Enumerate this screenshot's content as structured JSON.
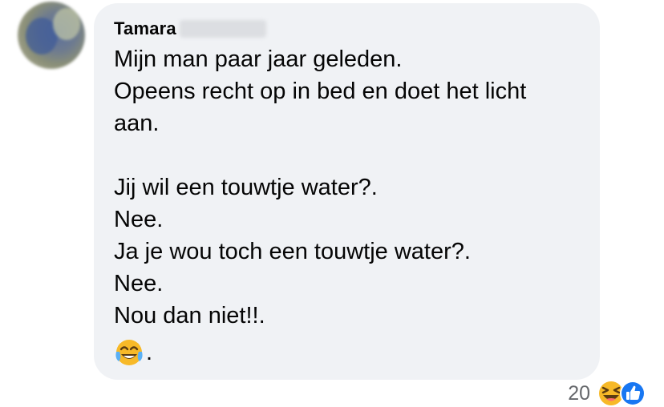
{
  "comment": {
    "author": "Tamara",
    "lines": [
      "Mijn man paar jaar geleden.",
      "Opeens recht op in bed en doet het licht",
      "aan.",
      "",
      "Jij wil een touwtje water?.",
      "Nee.",
      "Ja je wou toch een touwtje water?.",
      "Nee.",
      "Nou dan niet!!."
    ],
    "last_line_suffix": ".",
    "last_line_emoji": "face-with-tears-of-joy-icon"
  },
  "reactions": {
    "count": "20",
    "icons": [
      "haha-reaction-icon",
      "like-reaction-icon"
    ]
  },
  "colors": {
    "bubble": "#f0f2f5",
    "text": "#050505",
    "secondary_text": "#65676b",
    "like_blue": "#1877f2",
    "emoji_yellow": "#f7b928"
  }
}
